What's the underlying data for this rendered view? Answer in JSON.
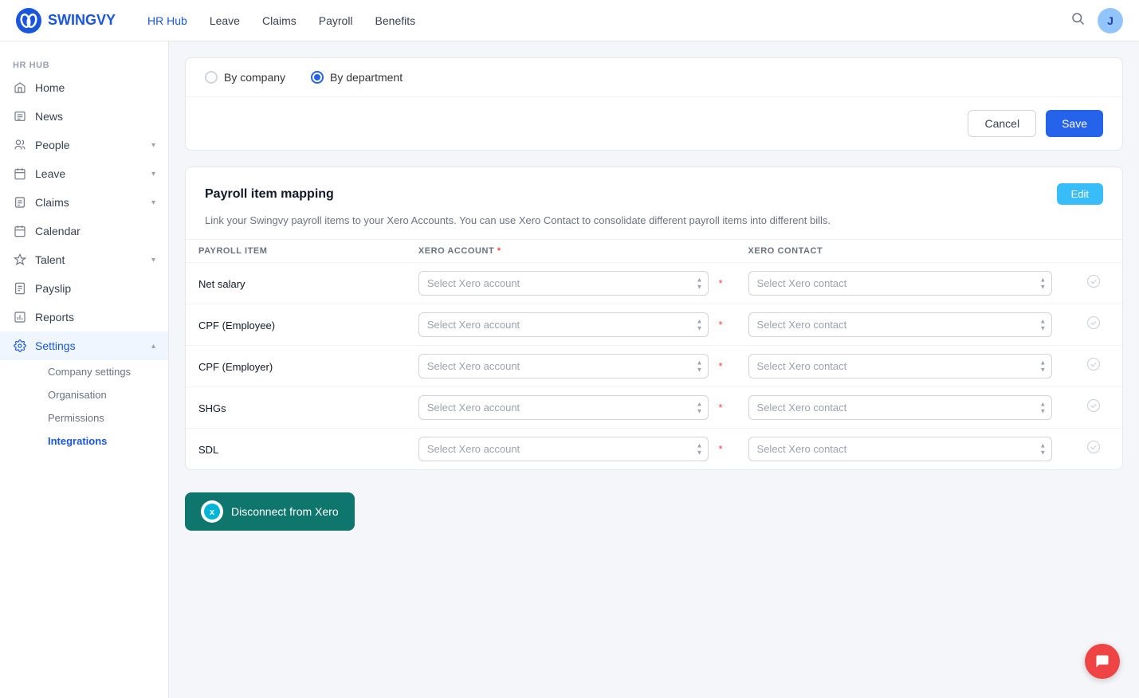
{
  "app": {
    "logo_text": "SWINGVY",
    "avatar_initial": "J"
  },
  "top_nav": {
    "links": [
      {
        "label": "HR Hub",
        "active": true
      },
      {
        "label": "Leave",
        "active": false
      },
      {
        "label": "Claims",
        "active": false
      },
      {
        "label": "Payroll",
        "active": false
      },
      {
        "label": "Benefits",
        "active": false
      }
    ]
  },
  "sidebar": {
    "section_label": "HR HUB",
    "items": [
      {
        "id": "home",
        "label": "Home",
        "icon": "home",
        "active": false
      },
      {
        "id": "news",
        "label": "News",
        "icon": "news",
        "active": false
      },
      {
        "id": "people",
        "label": "People",
        "icon": "people",
        "active": false,
        "has_chevron": true
      },
      {
        "id": "leave",
        "label": "Leave",
        "icon": "leave",
        "active": false,
        "has_chevron": true
      },
      {
        "id": "claims",
        "label": "Claims",
        "icon": "claims",
        "active": false,
        "has_chevron": true
      },
      {
        "id": "calendar",
        "label": "Calendar",
        "icon": "calendar",
        "active": false
      },
      {
        "id": "talent",
        "label": "Talent",
        "icon": "talent",
        "active": false,
        "has_chevron": true
      },
      {
        "id": "payslip",
        "label": "Payslip",
        "icon": "payslip",
        "active": false
      },
      {
        "id": "reports",
        "label": "Reports",
        "icon": "reports",
        "active": false
      },
      {
        "id": "settings",
        "label": "Settings",
        "icon": "settings",
        "active": true,
        "has_chevron": true,
        "expanded": true
      }
    ],
    "settings_sub": [
      {
        "id": "company-settings",
        "label": "Company settings",
        "active": false
      },
      {
        "id": "organisation",
        "label": "Organisation",
        "active": false
      },
      {
        "id": "permissions",
        "label": "Permissions",
        "active": false
      },
      {
        "id": "integrations",
        "label": "Integrations",
        "active": true
      }
    ]
  },
  "radio_section": {
    "by_company_label": "By company",
    "by_department_label": "By department",
    "by_company_checked": false,
    "by_department_checked": true
  },
  "actions": {
    "cancel_label": "Cancel",
    "save_label": "Save"
  },
  "mapping_section": {
    "title": "Payroll item mapping",
    "edit_label": "Edit",
    "description": "Link your Swingvy payroll items to your Xero Accounts. You can use Xero Contact to consolidate different payroll items into different bills.",
    "col_payroll_item": "PAYROLL ITEM",
    "col_xero_account": "XERO ACCOUNT",
    "col_xero_contact": "XERO CONTACT",
    "rows": [
      {
        "item": "Net salary",
        "xero_account_placeholder": "Select Xero account",
        "xero_contact_placeholder": "Select Xero contact"
      },
      {
        "item": "CPF (Employee)",
        "xero_account_placeholder": "Select Xero account",
        "xero_contact_placeholder": "Select Xero contact"
      },
      {
        "item": "CPF (Employer)",
        "xero_account_placeholder": "Select Xero account",
        "xero_contact_placeholder": "Select Xero contact"
      },
      {
        "item": "SHGs",
        "xero_account_placeholder": "Select Xero account",
        "xero_contact_placeholder": "Select Xero contact"
      },
      {
        "item": "SDL",
        "xero_account_placeholder": "Select Xero account",
        "xero_contact_placeholder": "Select Xero contact"
      }
    ]
  },
  "disconnect_btn": "Disconnect from Xero"
}
